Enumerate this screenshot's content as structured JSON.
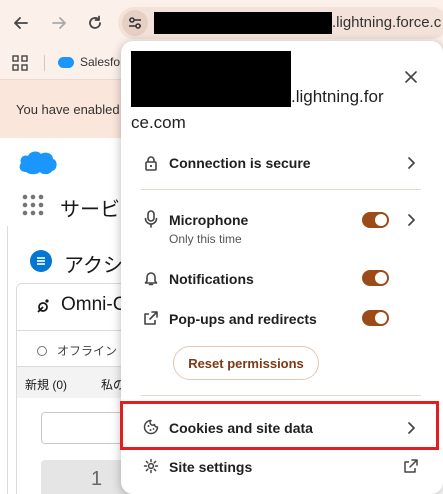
{
  "browser": {
    "url_suffix": ".lightning.force.c",
    "bookmark_label": "Salesfo",
    "infobar_text": "You have enabled"
  },
  "salesforce": {
    "app_name": "サービ",
    "action_title": "アクシ",
    "omni_title": "Omni-C",
    "status_label": "オフライン",
    "tab_new": "新規 (0)",
    "tab_mine": "私の",
    "count": "1"
  },
  "popup": {
    "domain_line1": ".lightning.for",
    "domain_line2": "ce.com",
    "close_icon": "close-icon",
    "connection_label": "Connection is secure",
    "microphone_label": "Microphone",
    "microphone_sub": "Only this time",
    "microphone_on": true,
    "notifications_label": "Notifications",
    "notifications_on": true,
    "popups_label": "Pop-ups and redirects",
    "popups_on": true,
    "reset_label": "Reset permissions",
    "cookies_label": "Cookies and site data",
    "site_settings_label": "Site settings"
  },
  "colors": {
    "toggle_on": "#9c4a17",
    "highlight": "#e02020",
    "chrome_bg": "#fbf0ea"
  }
}
